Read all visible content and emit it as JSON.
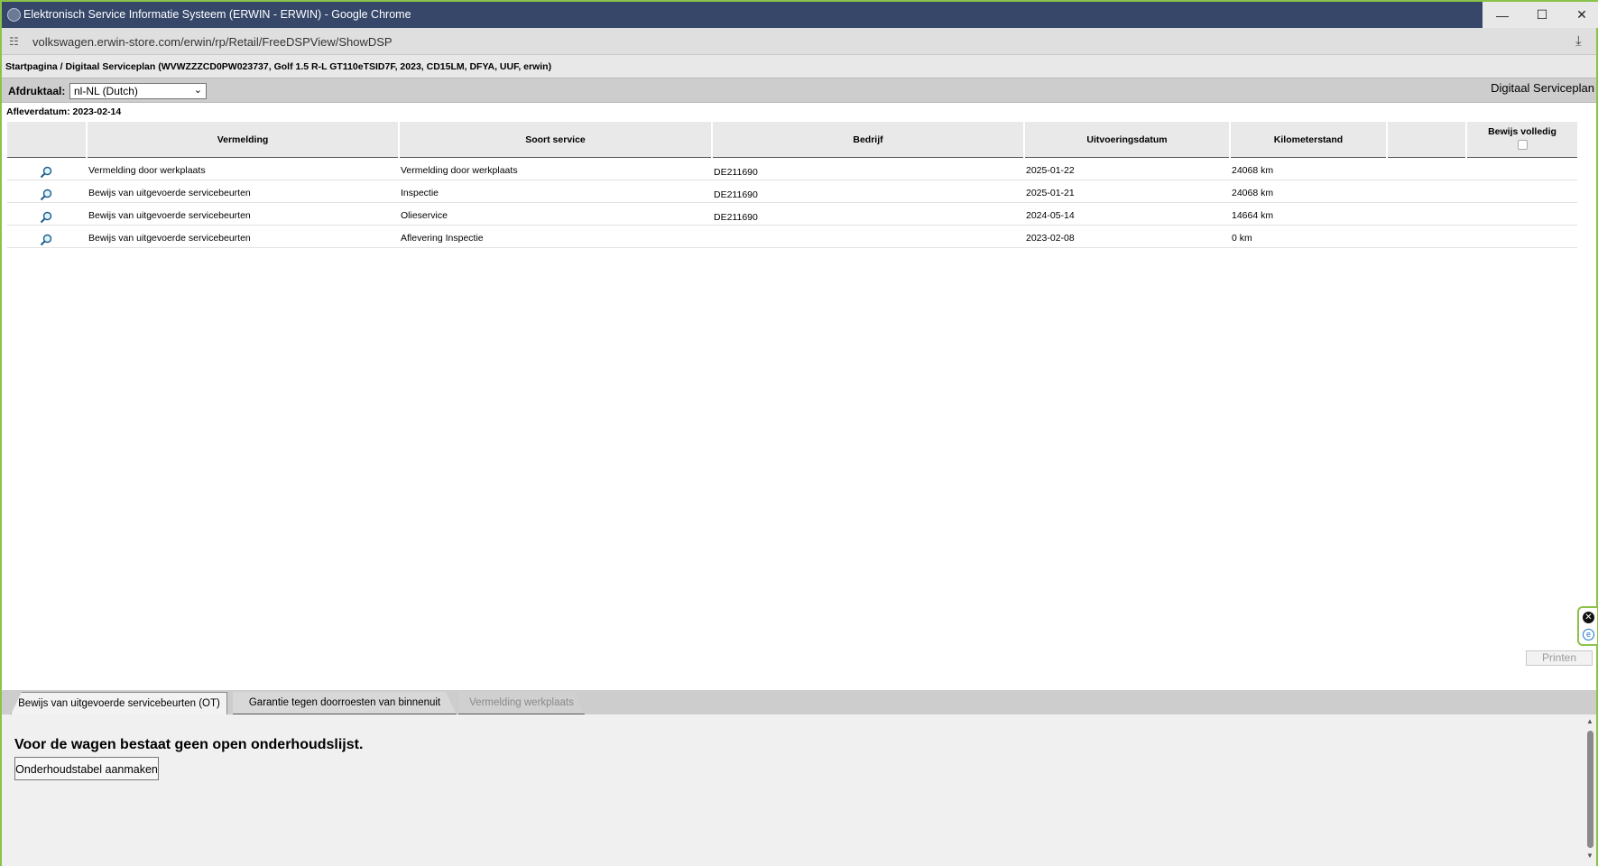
{
  "window": {
    "title": "Elektronisch Service Informatie Systeem (ERWIN - ERWIN) - Google Chrome",
    "minimize": "—",
    "maximize": "☐",
    "close": "✕"
  },
  "address": {
    "url": "volkswagen.erwin-store.com/erwin/rp/Retail/FreeDSPView/ShowDSP"
  },
  "breadcrumb": "Startpagina / Digitaal Serviceplan (WVWZZZCD0PW023737, Golf 1.5 R-L GT110eTSID7F, 2023, CD15LM, DFYA, UUF, erwin)",
  "language": {
    "label": "Afdruktaal:",
    "selected": "nl-NL (Dutch)"
  },
  "page_title": "Digitaal Serviceplan",
  "delivery_date": "Afleverdatum: 2023-02-14",
  "table": {
    "headers": [
      "",
      "Vermelding",
      "Soort service",
      "Bedrijf",
      "Uitvoeringsdatum",
      "Kilometerstand",
      "",
      "Bewijs volledig"
    ],
    "rows": [
      {
        "vermelding": "Vermelding door werkplaats",
        "soort": "Vermelding door werkplaats",
        "bedrijf": "DE211690",
        "datum": "2025-01-22",
        "km": "24068 km"
      },
      {
        "vermelding": "Bewijs van uitgevoerde servicebeurten",
        "soort": "Inspectie",
        "bedrijf": "DE211690",
        "datum": "2025-01-21",
        "km": "24068 km"
      },
      {
        "vermelding": "Bewijs van uitgevoerde servicebeurten",
        "soort": "Olieservice",
        "bedrijf": "DE211690",
        "datum": "2024-05-14",
        "km": "14664 km"
      },
      {
        "vermelding": "Bewijs van uitgevoerde servicebeurten",
        "soort": "Aflevering Inspectie",
        "bedrijf": "",
        "datum": "2023-02-08",
        "km": "0 km"
      }
    ]
  },
  "print_button": "Printen",
  "tabs": [
    {
      "label": "Bewijs van uitgevoerde servicebeurten (OT)",
      "active": true
    },
    {
      "label": "Garantie tegen doorroesten van binnenuit",
      "active": false
    },
    {
      "label": "Vermelding werkplaats",
      "active": false
    }
  ],
  "panel": {
    "message": "Voor de wagen bestaat geen open onderhoudslijst.",
    "create_button": "Onderhoudstabel aanmaken"
  },
  "colors": {
    "titlebar": "#36476a",
    "window_border": "#8bc34a",
    "grid_header": "#e9e9e9"
  }
}
